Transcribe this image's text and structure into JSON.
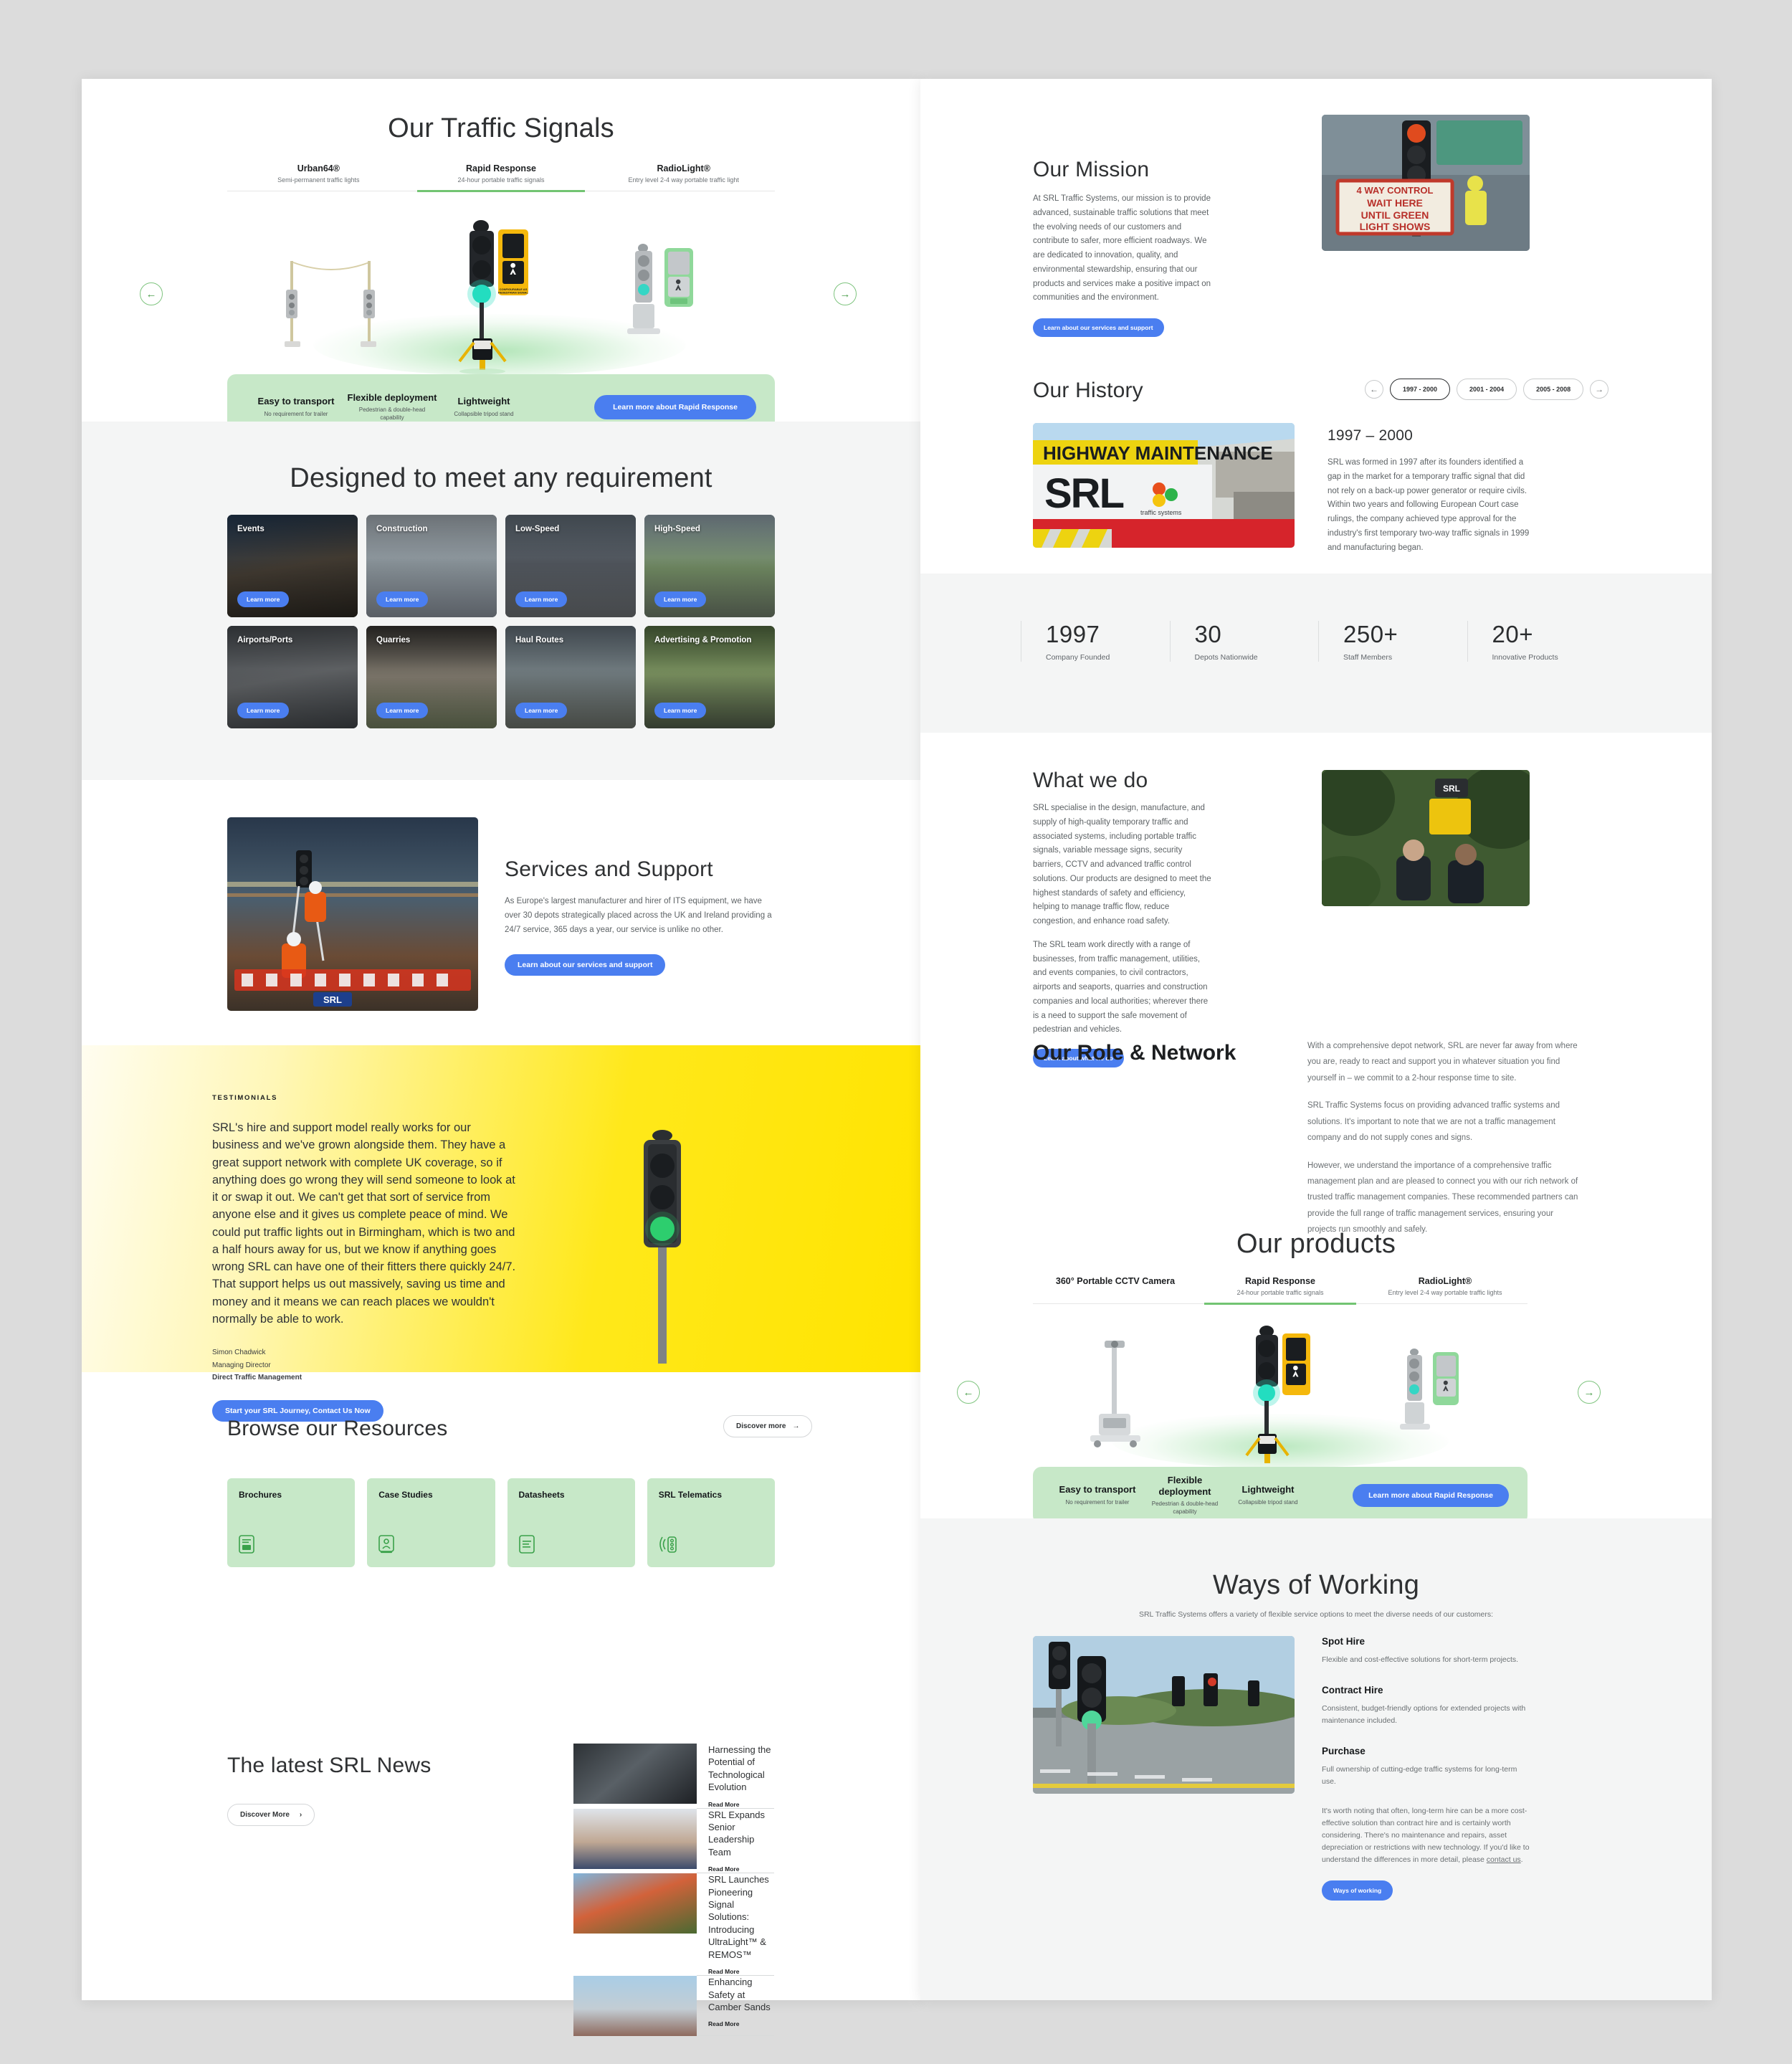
{
  "left_page": {
    "traffic_signals": {
      "title": "Our Traffic Signals",
      "tabs": [
        {
          "name": "Urban64®",
          "sub": "Semi-permanent traffic lights",
          "active": false
        },
        {
          "name": "Rapid Response",
          "sub": "24-hour portable traffic signals",
          "active": true
        },
        {
          "name": "RadioLight®",
          "sub": "Entry level 2-4 way portable traffic light",
          "active": false
        }
      ],
      "prev_arrow": "←",
      "next_arrow": "→",
      "features": [
        {
          "title": "Easy to transport",
          "sub": "No requirement for trailer"
        },
        {
          "title": "Flexible deployment",
          "sub": "Pedestrian & double-head capability"
        },
        {
          "title": "Lightweight",
          "sub": "Collapsible tripod stand"
        }
      ],
      "cta": "Learn more about Rapid Response"
    },
    "requirements": {
      "title": "Designed to meet any requirement",
      "cards": [
        {
          "label": "Events",
          "button": "Learn more",
          "ph": "ph-ev"
        },
        {
          "label": "Construction",
          "button": "Learn more",
          "ph": "ph-cn"
        },
        {
          "label": "Low-Speed",
          "button": "Learn more",
          "ph": "ph-ls"
        },
        {
          "label": "High-Speed",
          "button": "Learn more",
          "ph": "ph-hs"
        },
        {
          "label": "Airports/Ports",
          "button": "Learn more",
          "ph": "ph-ap"
        },
        {
          "label": "Quarries",
          "button": "Learn more",
          "ph": "ph-qr"
        },
        {
          "label": "Haul Routes",
          "button": "Learn more",
          "ph": "ph-hr"
        },
        {
          "label": "Advertising & Promotion",
          "button": "Learn more",
          "ph": "ph-adv"
        }
      ]
    },
    "services": {
      "title": "Services and Support",
      "body": "As Europe's largest manufacturer and hirer of ITS equipment, we have over 30 depots strategically placed across the UK and Ireland providing a 24/7 service, 365 days a year, our service is unlike no other.",
      "cta": "Learn about our services and support"
    },
    "testimonials": {
      "eyebrow": "TESTIMONIALS",
      "quote": "SRL's hire and support model really works for our business and we've grown alongside them. They have a great support network with complete UK coverage, so if anything does go wrong they will send someone to look at it or swap it out. We can't get that sort of service from anyone else and it gives us complete peace of mind. We could put traffic lights out in Birmingham, which is two and a half hours away for us, but we know if anything goes wrong SRL can have one of their fitters there quickly 24/7. That support helps us out massively, saving us time and money and it means we can reach places we wouldn't normally be able to work.",
      "author": "Simon Chadwick",
      "role": "Managing Director",
      "company": "Direct Traffic Management",
      "cta": "Start your SRL Journey, Contact Us Now"
    },
    "resources": {
      "title": "Browse our Resources",
      "discover": "Discover more",
      "discover_arrow": "→",
      "cards": [
        {
          "title": "Brochures",
          "icon": "brochure-icon"
        },
        {
          "title": "Case Studies",
          "icon": "case-study-icon"
        },
        {
          "title": "Datasheets",
          "icon": "datasheet-icon"
        },
        {
          "title": "SRL Telematics",
          "icon": "telematics-icon"
        }
      ]
    },
    "news": {
      "title": "The latest SRL News",
      "discover": "Discover More",
      "discover_arrow": "›",
      "items": [
        {
          "title": "Harnessing the Potential of Technological Evolution",
          "read": "Read More",
          "ph": "ph-news1"
        },
        {
          "title": "SRL Expands Senior Leadership Team",
          "read": "Read More",
          "ph": "ph-news2"
        },
        {
          "title": "SRL Launches Pioneering Signal Solutions: Introducing UltraLight™ & REMOS™",
          "read": "Read More",
          "ph": "ph-news3"
        },
        {
          "title": "Enhancing Safety at Camber Sands",
          "read": "Read More",
          "ph": "ph-news4"
        }
      ]
    }
  },
  "right_page": {
    "mission": {
      "title": "Our Mission",
      "body": "At SRL Traffic Systems, our mission is to provide advanced, sustainable traffic solutions that meet the evolving needs of our customers and contribute to safer, more efficient roadways. We are dedicated to innovation, quality, and environmental stewardship, ensuring that our products and services make a positive impact on communities and the environment.",
      "cta": "Learn about our services and support",
      "image_caption_line1": "4 WAY CONTROL",
      "image_caption_line2": "WAIT HERE",
      "image_caption_line3": "UNTIL GREEN",
      "image_caption_line4": "LIGHT SHOWS"
    },
    "history": {
      "title": "Our History",
      "prev_arrow": "←",
      "next_arrow": "→",
      "pills": [
        {
          "label": "1997 - 2000",
          "active": true
        },
        {
          "label": "2001 - 2004",
          "active": false
        },
        {
          "label": "2005 - 2008",
          "active": false
        }
      ],
      "period": "1997 – 2000",
      "body": "SRL was formed in 1997 after its founders identified a gap in the market for a temporary traffic signal that did not rely on a back-up power generator or require civils. Within two years and following European Court case rulings, the company achieved type approval for the industry's first temporary two-way traffic signals in 1999 and manufacturing began.",
      "image_word": "HIGHWAY MAINTENANCE",
      "image_logo": "SRL",
      "image_sub": "traffic systems"
    },
    "stats": [
      {
        "number": "1997",
        "label": "Company Founded"
      },
      {
        "number": "30",
        "label": "Depots Nationwide"
      },
      {
        "number": "250+",
        "label": "Staff Members"
      },
      {
        "number": "20+",
        "label": "Innovative Products"
      }
    ],
    "what_we_do": {
      "title": "What we do",
      "p1": "SRL specialise in the design, manufacture, and supply of high-quality temporary traffic and associated systems, including portable traffic signals, variable message signs, security barriers, CCTV and advanced traffic control solutions. Our products are designed to meet the highest standards of safety and efficiency, helping to manage traffic flow, reduce congestion, and enhance road safety.",
      "p2": "The SRL team work directly with a range of businesses, from traffic management, utilities, and events companies, to civil contractors, airports and seaports, quarries and construction companies and local authorities; wherever there is a need to support the safe movement of pedestrian and vehicles.",
      "cta": "Learn about what we do"
    },
    "role_network": {
      "title": "Our Role & Network",
      "p1": "With a comprehensive depot network, SRL are never far away from where you are, ready to react and support you in whatever situation you find yourself in – we commit to a 2-hour response time to site.",
      "p2": "SRL Traffic Systems focus on providing advanced traffic systems and solutions. It's important to note that we are not a traffic management company and do not supply cones and signs.",
      "p3": "However, we understand the importance of a comprehensive traffic management plan and are pleased to connect you with our rich network of trusted traffic management companies. These recommended partners can provide the full range of traffic management services, ensuring your projects run smoothly and safely."
    },
    "products": {
      "title": "Our products",
      "tabs": [
        {
          "name": "360° Portable CCTV Camera",
          "sub": "",
          "active": false
        },
        {
          "name": "Rapid Response",
          "sub": "24-hour portable traffic signals",
          "active": true
        },
        {
          "name": "RadioLight®",
          "sub": "Entry level 2-4 way portable traffic lights",
          "active": false
        }
      ],
      "prev_arrow": "←",
      "next_arrow": "→",
      "features": [
        {
          "title": "Easy to transport",
          "sub": "No requirement for trailer"
        },
        {
          "title": "Flexible deployment",
          "sub": "Pedestrian & double-head capability"
        },
        {
          "title": "Lightweight",
          "sub": "Collapsible tripod stand"
        }
      ],
      "cta": "Learn more about Rapid Response"
    },
    "ways_of_working": {
      "title": "Ways of Working",
      "subtitle": "SRL Traffic Systems offers a variety of flexible service options to meet the diverse needs of our customers:",
      "items": [
        {
          "heading": "Spot Hire",
          "body": "Flexible and cost-effective solutions for short-term projects."
        },
        {
          "heading": "Contract Hire",
          "body": "Consistent, budget-friendly options for extended projects with maintenance included."
        },
        {
          "heading": "Purchase",
          "body": "Full ownership of cutting-edge traffic systems for long-term use."
        }
      ],
      "note_before_link": "It's worth noting that often, long-term hire can be a more cost-effective solution than contract hire and is certainly worth considering. There's no maintenance and repairs, asset depreciation or restrictions with new technology. If you'd like to understand the differences in more detail, please ",
      "note_link": "contact us",
      "note_after_link": ".",
      "cta": "Ways of working"
    }
  },
  "colors": {
    "accent_blue": "#4a7ef0",
    "accent_green": "#72c472",
    "pale_green": "#c7e8c8",
    "yellow": "#ffe81a",
    "page_bg": "#dcdcdc"
  }
}
